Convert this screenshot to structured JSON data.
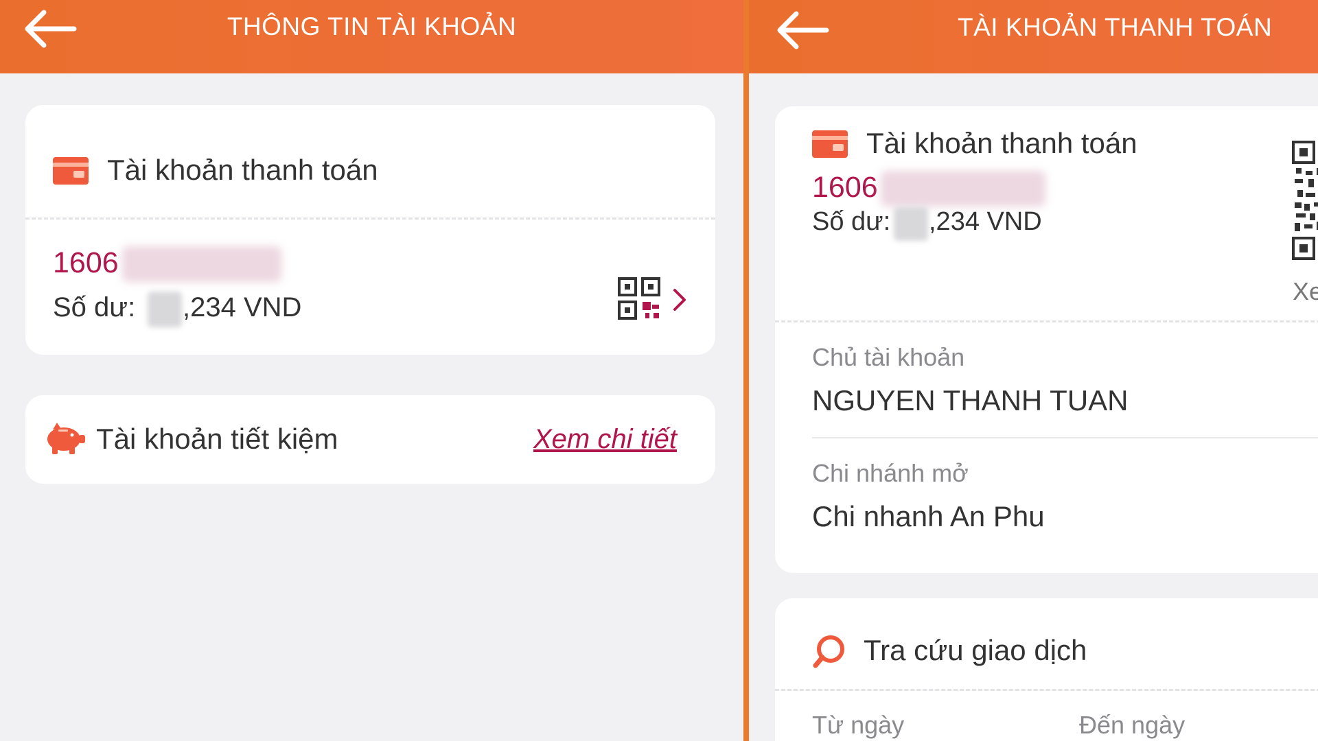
{
  "left_screen": {
    "header": {
      "title": "THÔNG TIN TÀI KHOẢN",
      "back_icon": "arrow-left-icon"
    },
    "payment_card": {
      "title": "Tài khoản thanh toán",
      "icon": "card-icon",
      "account_prefix": "1606",
      "balance_label": "Số dư:",
      "balance_suffix": ",234 VND",
      "qr_icon": "qr-code-icon",
      "chevron_icon": "chevron-right-icon"
    },
    "savings_card": {
      "title": "Tài khoản tiết kiệm",
      "icon": "piggy-bank-icon",
      "link": "Xem chi tiết"
    }
  },
  "right_screen": {
    "header": {
      "title": "TÀI KHOẢN THANH TOÁN",
      "back_icon": "arrow-left-icon"
    },
    "account_card": {
      "title": "Tài khoản thanh toán",
      "icon": "card-icon",
      "account_prefix": "1606",
      "balance_label": "Số dư:",
      "balance_suffix": ",234 VND",
      "qr_icon": "qr-code-icon",
      "qr_caption": "Xe",
      "owner_label": "Chủ tài khoản",
      "owner_value": "NGUYEN THANH TUAN",
      "branch_label": "Chi nhánh mở",
      "branch_value": "Chi nhanh An Phu"
    },
    "search_card": {
      "title": "Tra cứu giao dịch",
      "icon": "search-icon",
      "from_label": "Từ ngày",
      "to_label": "Đến ngày"
    }
  },
  "colors": {
    "header": "#ea6f2e",
    "accent": "#b0154c",
    "icon_orange": "#ef5a3c",
    "background": "#f1f1f3"
  }
}
